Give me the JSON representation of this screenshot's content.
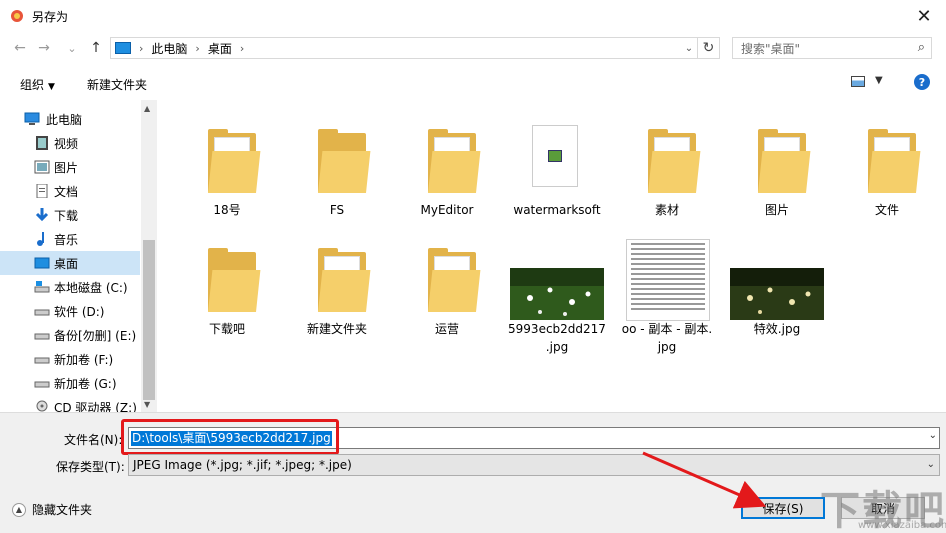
{
  "window": {
    "title": "另存为",
    "close_symbol": "✕"
  },
  "nav": {
    "back": "←",
    "forward": "→",
    "recent": "⌄",
    "up": "↑"
  },
  "address": {
    "crumbs": [
      "此电脑",
      "桌面"
    ],
    "sep": "›",
    "refresh": "↻",
    "dropdown": "⌄"
  },
  "search": {
    "placeholder": "搜索\"桌面\"",
    "icon": "⌕"
  },
  "toolbar": {
    "organize": "组织",
    "new_folder": "新建文件夹",
    "help": "?"
  },
  "sidebar": {
    "items": [
      {
        "label": "此电脑",
        "icon": "pc-icon"
      },
      {
        "label": "视频",
        "icon": "video-icon"
      },
      {
        "label": "图片",
        "icon": "picture-icon"
      },
      {
        "label": "文档",
        "icon": "document-icon"
      },
      {
        "label": "下载",
        "icon": "download-icon"
      },
      {
        "label": "音乐",
        "icon": "music-icon"
      },
      {
        "label": "桌面",
        "icon": "desktop-icon",
        "selected": true
      },
      {
        "label": "本地磁盘 (C:)",
        "icon": "drive-icon"
      },
      {
        "label": "软件 (D:)",
        "icon": "drive-icon"
      },
      {
        "label": "备份[勿删] (E:)",
        "icon": "drive-icon"
      },
      {
        "label": "新加卷 (F:)",
        "icon": "drive-icon"
      },
      {
        "label": "新加卷 (G:)",
        "icon": "drive-icon"
      },
      {
        "label": "CD 驱动器 (Z:)",
        "icon": "cd-drive-icon"
      }
    ]
  },
  "files": [
    {
      "name": "18号",
      "type": "folder"
    },
    {
      "name": "FS",
      "type": "folder"
    },
    {
      "name": "MyEditor",
      "type": "folder"
    },
    {
      "name": "watermarksoft",
      "type": "folder"
    },
    {
      "name": "素材",
      "type": "folder"
    },
    {
      "name": "图片",
      "type": "folder"
    },
    {
      "name": "文件",
      "type": "folder"
    },
    {
      "name": "下载吧",
      "type": "folder"
    },
    {
      "name": "新建文件夹",
      "type": "folder"
    },
    {
      "name": "运营",
      "type": "folder"
    },
    {
      "name": "5993ecb2dd217\n.jpg",
      "type": "photo"
    },
    {
      "name": "oo - 副本 - 副本.\njpg",
      "type": "doc"
    },
    {
      "name": "特效.jpg",
      "type": "photo-dark"
    }
  ],
  "form": {
    "filename_label": "文件名(N):",
    "filename_value": "D:\\tools\\桌面\\5993ecb2dd217.jpg",
    "filetype_label": "保存类型(T):",
    "filetype_value": "JPEG Image (*.jpg; *.jif; *.jpeg; *.jpe)",
    "hide_folders": "隐藏文件夹",
    "save": "保存(S)",
    "cancel": "取消"
  },
  "watermark": {
    "text": "下载吧",
    "sub": "www.xiazaiba.com"
  },
  "colors": {
    "accent": "#0078d7",
    "highlight": "#e3191b",
    "folder": "#f5cf6a",
    "selected": "#cce4f7"
  }
}
